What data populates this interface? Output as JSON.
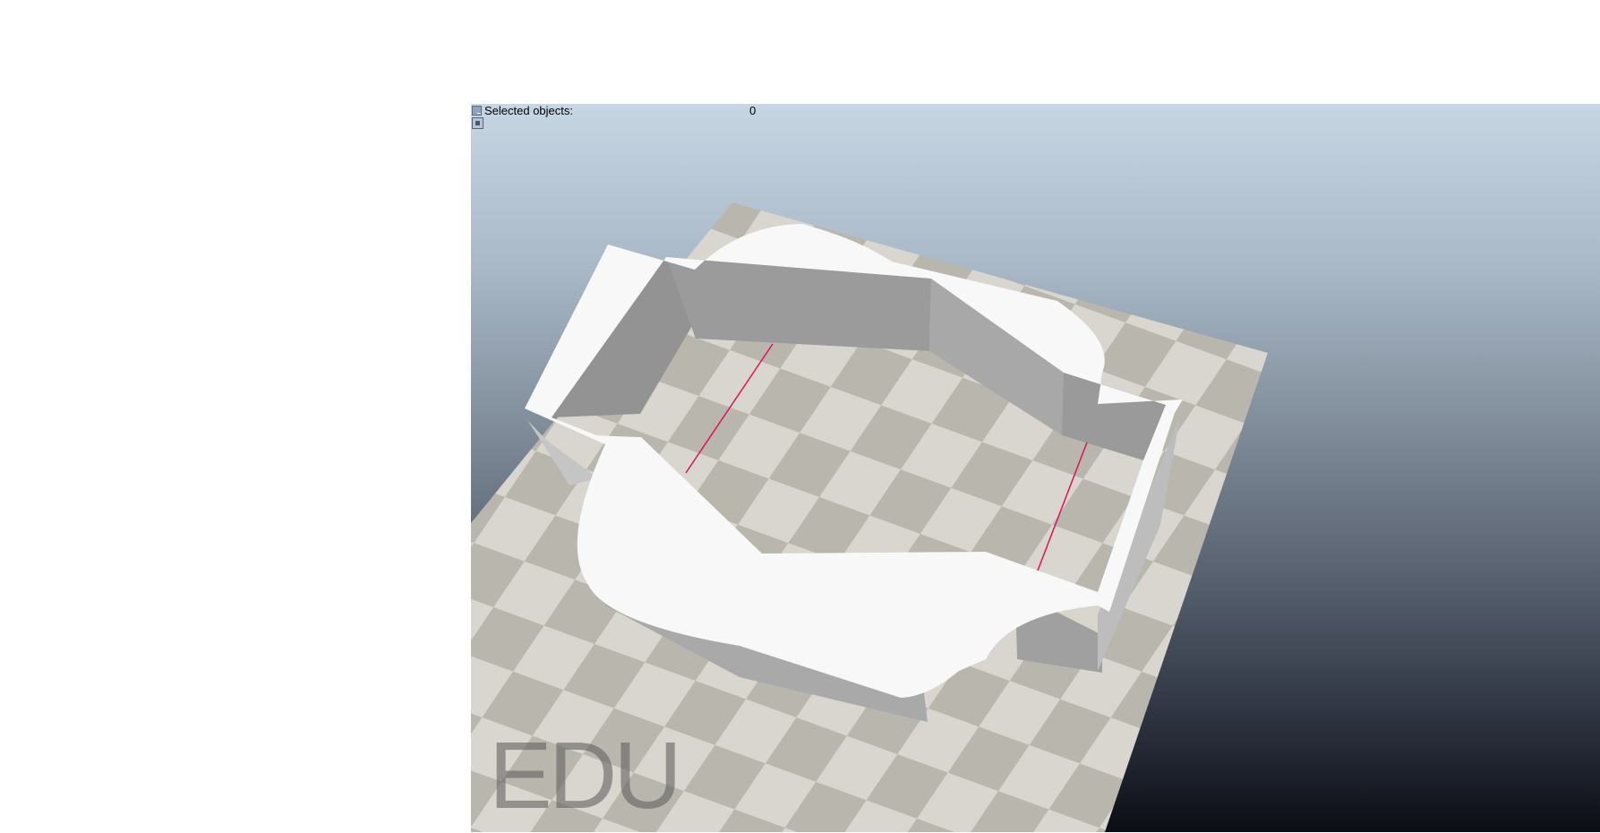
{
  "overlay": {
    "selected_label": "Selected objects:",
    "selected_count": "0"
  },
  "watermark": {
    "text": "EDU"
  },
  "scene": {
    "floor_colors": [
      "#d9d6cf",
      "#b9b6ae"
    ],
    "wall_top_color": "#f8f8f8",
    "wall_side_color": "#a6a6a6",
    "marker_line_color": "#e0105a"
  }
}
